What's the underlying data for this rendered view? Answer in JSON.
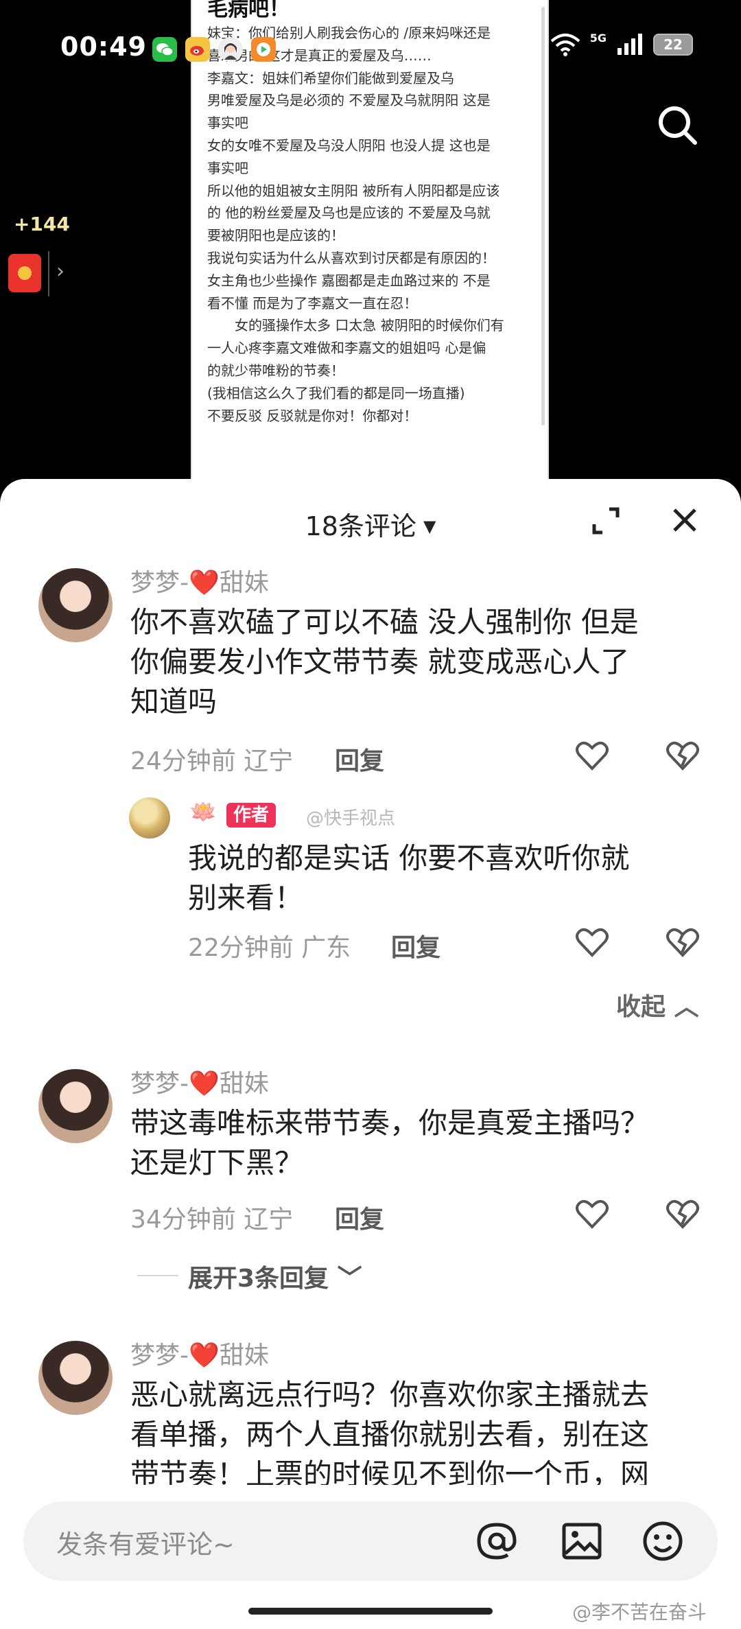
{
  "status_bar": {
    "time": "00:49",
    "network": "5G",
    "battery": "22",
    "app_icons": [
      "wechat-icon",
      "weibo-icon",
      "avatar-app-icon",
      "video-app-icon"
    ]
  },
  "video": {
    "reward_count": "+144",
    "doc_title": "毛病吧！",
    "doc_lines": [
      "妹宝：你们给别人刷我会伤心的 /原来妈咪还是",
      "喜欢男的/这才是真正的爱屋及乌……",
      "李嘉文：姐妹们希望你们能做到爱屋及乌",
      "男唯爱屋及乌是必须的 不爱屋及乌就阴阳 这是",
      "事实吧",
      "女的女唯不爱屋及乌没人阴阳 也没人提 这也是",
      "事实吧",
      "所以他的姐姐被女主阴阳 被所有人阴阳都是应该",
      "的 他的粉丝爱屋及乌也是应该的 不爱屋及乌就",
      "要被阴阳也是应该的！",
      "我说句实话为什么从喜欢到讨厌都是有原因的！",
      "女主角也少些操作 嘉圈都是走血路过来的 不是",
      "看不懂 而是为了李嘉文一直在忍！",
      "　　女的骚操作太多 口太急 被阴阳的时候你们有",
      "一人心疼李嘉文难做和李嘉文的姐姐吗 心是偏",
      "的就少带唯粉的节奏！",
      "(我相信这么久了我们看的都是同一场直播)",
      "不要反驳 反驳就是你对！你都对！"
    ]
  },
  "sheet": {
    "comment_count": "18条评论",
    "comments": [
      {
        "user_prefix": "梦梦-",
        "user_heart": "❤️",
        "user_suffix": "甜妹",
        "lines": [
          "你不喜欢磕了可以不磕 没人强制你 但是",
          "你偏要发小作文带节奏 就变成恶心人了",
          "知道吗"
        ],
        "meta": "24分钟前 辽宁",
        "reply": "回复"
      },
      {
        "user_prefix": "梦梦-",
        "user_heart": "❤️",
        "user_suffix": "甜妹",
        "lines": [
          "带这毒唯标来带节奏，你是真爱主播吗？",
          "还是灯下黑？"
        ],
        "meta": "34分钟前 辽宁",
        "reply": "回复"
      },
      {
        "user_prefix": "梦梦-",
        "user_heart": "❤️",
        "user_suffix": "甜妹",
        "lines": [
          "恶心就离远点行吗？你喜欢你家主播就去",
          "看单播，两个人直播你就别去看，别在这",
          "带节奏！上票的时候见不到你一个币，网"
        ]
      }
    ],
    "author_reply": {
      "lotus": "🪷",
      "badge": "作者",
      "watermark": "@快手视点",
      "lines": [
        "我说的都是实话 你要不喜欢听你就",
        "别来看！"
      ],
      "meta": "22分钟前 广东",
      "reply": "回复"
    },
    "collapse": "收起",
    "expand_replies": "展开3条回复"
  },
  "input": {
    "placeholder": "发条有爱评论~"
  },
  "credit": "@李不苦在奋斗"
}
